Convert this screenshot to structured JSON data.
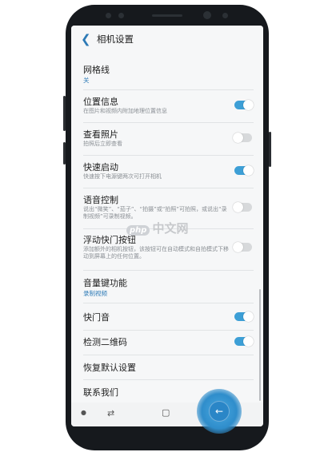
{
  "header": {
    "back_icon": "back-chevron-icon",
    "title": "相机设置"
  },
  "settings": [
    {
      "label": "网格线",
      "sub": "关",
      "sub_accent": true
    },
    {
      "label": "位置信息",
      "sub": "在图片和视频内附加地理位置信息",
      "toggle": true
    },
    {
      "label": "查看照片",
      "sub": "拍照后立即查看",
      "toggle": false
    },
    {
      "label": "快速启动",
      "sub": "快速按下电源键两次可打开相机",
      "toggle": true
    },
    {
      "label": "语音控制",
      "sub": "说出“微笑”、“茄子”、“拍摄”或“拍照”可拍照，或说出“录制视频”可录制视频。",
      "toggle": false
    },
    {
      "label": "浮动快门按钮",
      "sub": "添加额外的相机按钮，该按钮可在自动模式和自拍模式下移动到屏幕上的任何位置。",
      "toggle": false
    },
    {
      "label": "音量键功能",
      "sub": "录制视频",
      "sub_accent": true
    },
    {
      "label": "快门音",
      "toggle": true
    },
    {
      "label": "检测二维码",
      "toggle": true
    },
    {
      "label": "恢复默认设置"
    },
    {
      "label": "联系我们"
    }
  ],
  "watermark": {
    "logo": "php",
    "text": "中文网"
  },
  "navbar": {
    "recent_icon": "recent-apps-icon",
    "home_icon": "home-icon",
    "back_icon": "back-arrow-icon"
  },
  "colors": {
    "accent": "#3d9fd6",
    "toggle_off": "#d7d9db",
    "background": "#f6f7f8"
  }
}
